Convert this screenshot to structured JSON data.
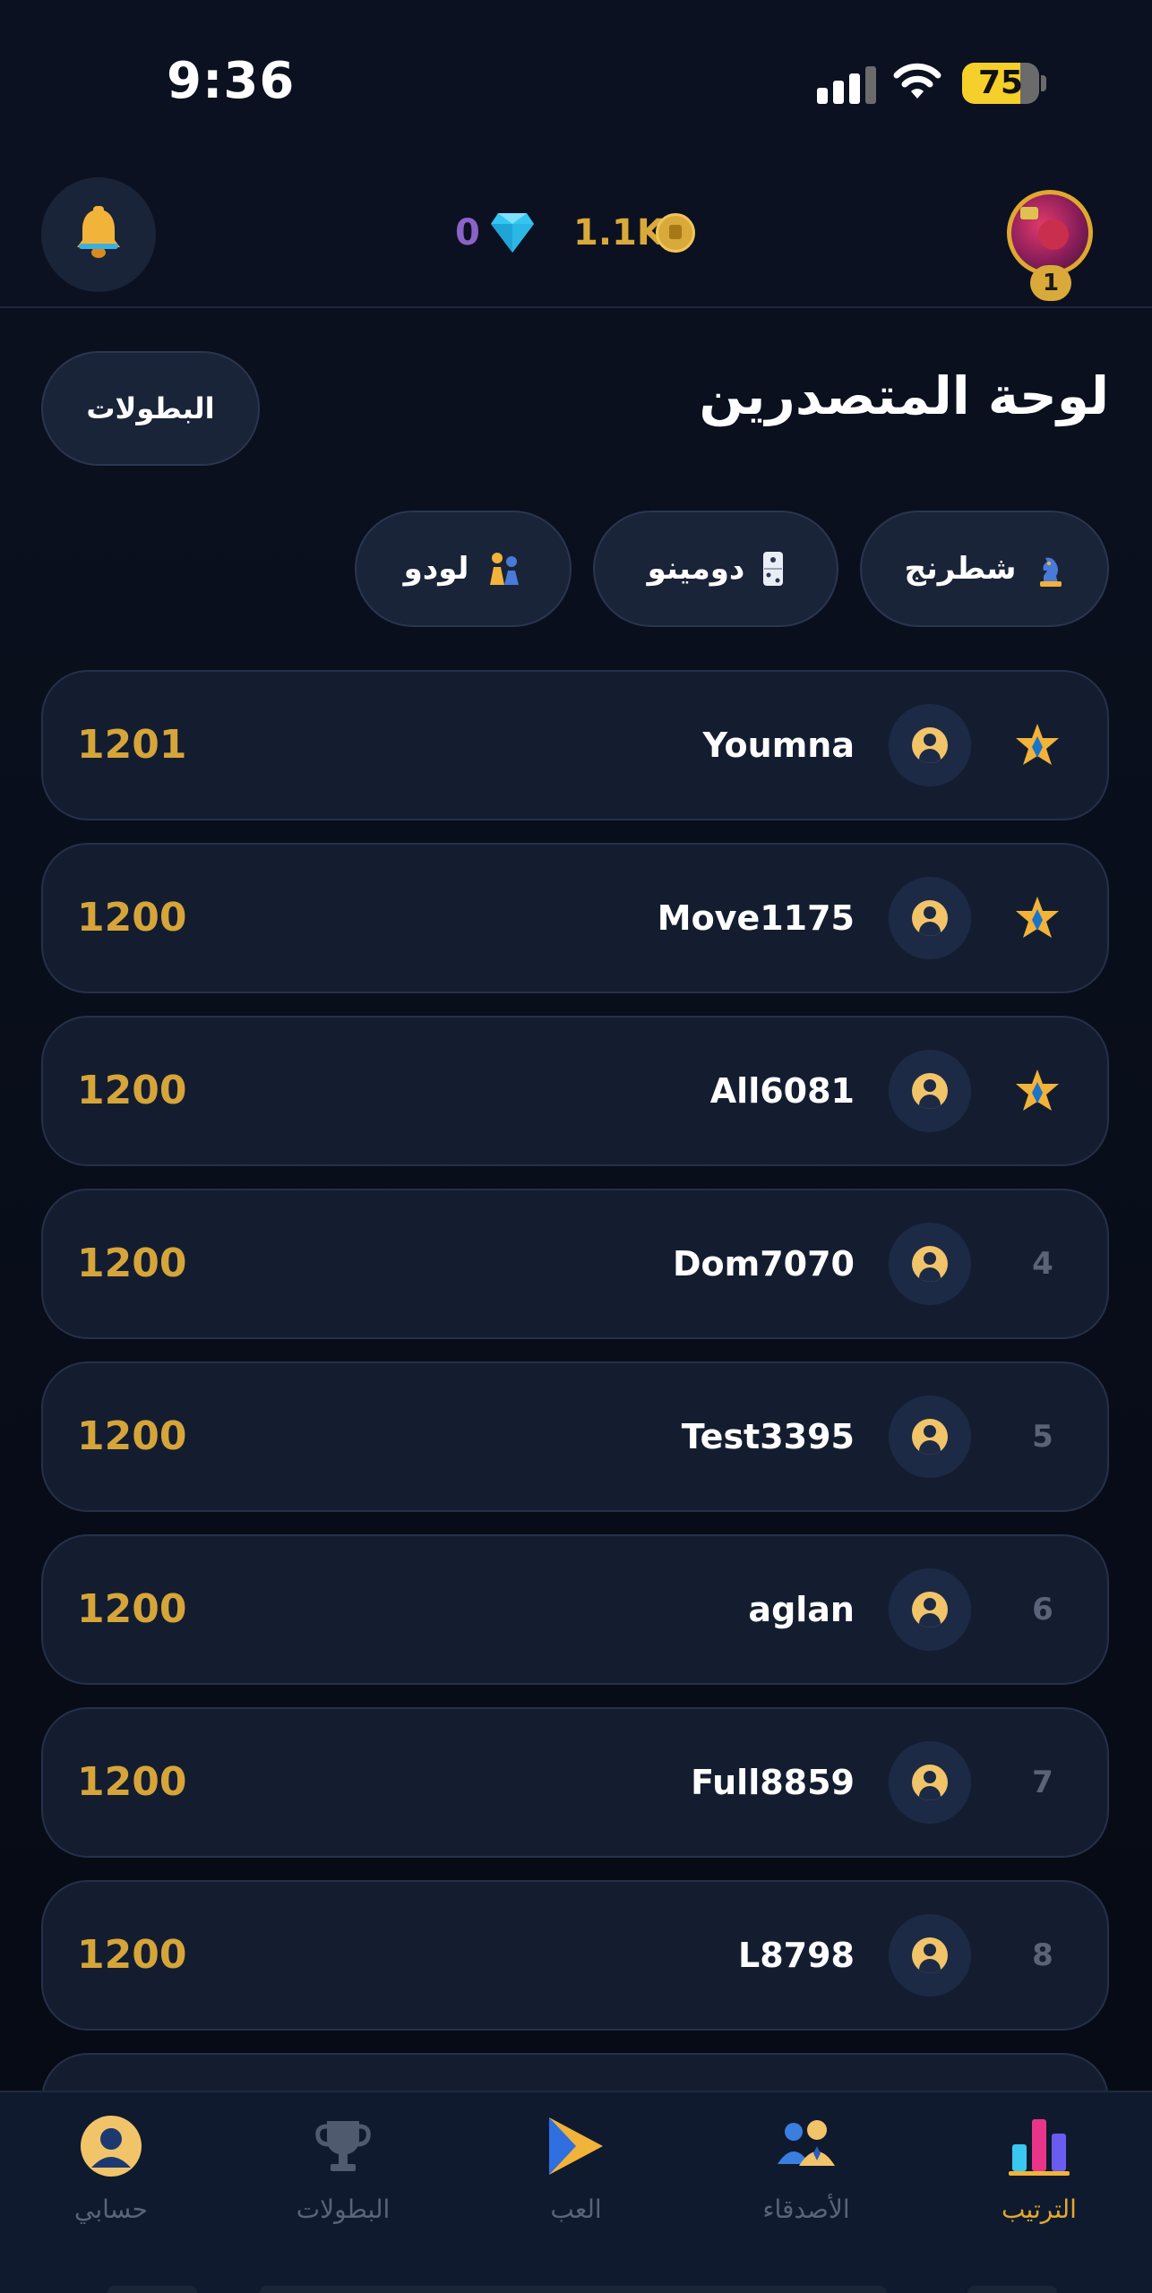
{
  "status_bar": {
    "time": "9:36",
    "battery_percent": "75",
    "battery_level": 0.75
  },
  "header": {
    "gems": "0",
    "coins": "1.1K",
    "level": "1"
  },
  "page": {
    "title": "لوحة المتصدرين",
    "tournaments_button": "البطولات"
  },
  "game_filters": [
    {
      "label": "شطرنج",
      "icon": "chess-piece-icon"
    },
    {
      "label": "دومينو",
      "icon": "domino-icon"
    },
    {
      "label": "لودو",
      "icon": "ludo-players-icon"
    }
  ],
  "leaderboard": [
    {
      "rank": "1",
      "top": true,
      "username": "Youmna",
      "score": "1201"
    },
    {
      "rank": "2",
      "top": true,
      "username": "Move1175",
      "score": "1200"
    },
    {
      "rank": "3",
      "top": true,
      "username": "All6081",
      "score": "1200"
    },
    {
      "rank": "4",
      "top": false,
      "username": "Dom7070",
      "score": "1200"
    },
    {
      "rank": "5",
      "top": false,
      "username": "Test3395",
      "score": "1200"
    },
    {
      "rank": "6",
      "top": false,
      "username": "aglan",
      "score": "1200"
    },
    {
      "rank": "7",
      "top": false,
      "username": "Full8859",
      "score": "1200"
    },
    {
      "rank": "8",
      "top": false,
      "username": "L8798",
      "score": "1200"
    }
  ],
  "bottom_nav": {
    "account": "حسابي",
    "tournaments": "البطولات",
    "play": "العب",
    "friends": "الأصدقاء",
    "ranking": "الترتيب",
    "active": "ranking"
  },
  "colors": {
    "accent_gold": "#d6a539",
    "gem_purple": "#8a63c9",
    "card_bg": "#141d30",
    "page_bg": "#0b1120"
  }
}
